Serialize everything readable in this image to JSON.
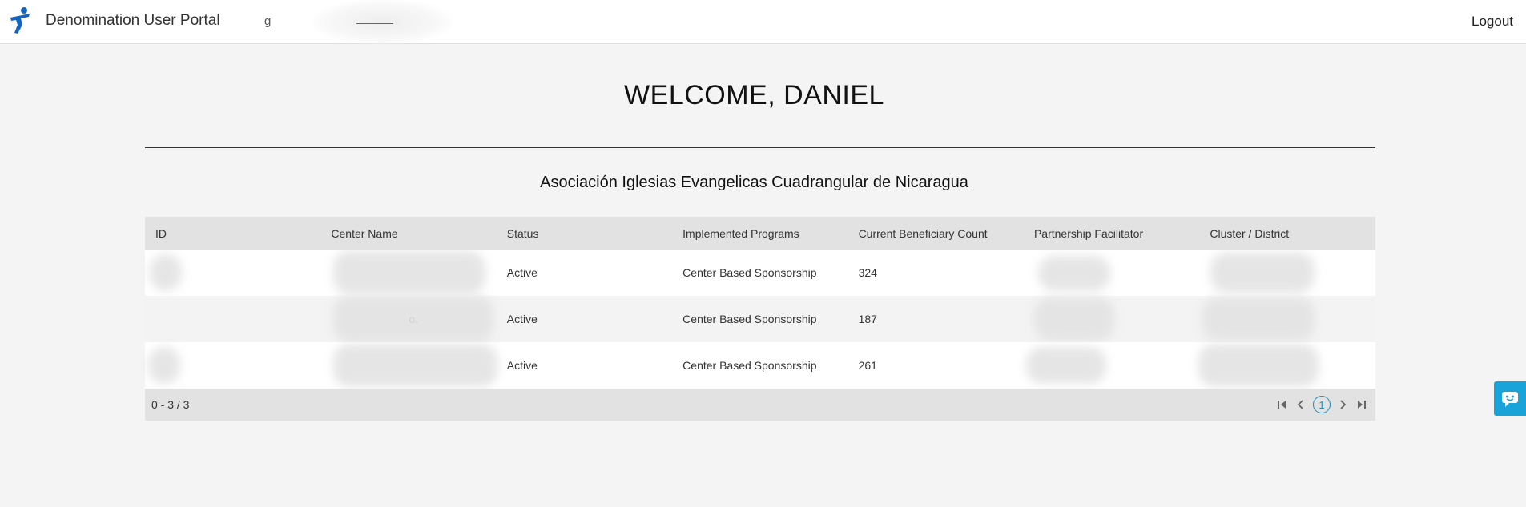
{
  "header": {
    "app_title": "Denomination User Portal",
    "org_short": "g",
    "logout_label": "Logout"
  },
  "welcome": "WELCOME, DANIEL",
  "organization": "Asociación Iglesias Evangelicas Cuadrangular de Nicaragua",
  "table": {
    "columns": [
      "ID",
      "Center Name",
      "Status",
      "Implemented Programs",
      "Current Beneficiary Count",
      "Partnership Facilitator",
      "Cluster / District"
    ],
    "rows": [
      {
        "id": "",
        "center_name": "",
        "status": "Active",
        "programs": "Center Based Sponsorship",
        "count": "324",
        "facilitator": "",
        "cluster": ""
      },
      {
        "id": "",
        "center_name": "o.",
        "status": "Active",
        "programs": "Center Based Sponsorship",
        "count": "187",
        "facilitator": "",
        "cluster": ""
      },
      {
        "id": "",
        "center_name": "",
        "status": "Active",
        "programs": "Center Based Sponsorship",
        "count": "261",
        "facilitator": "",
        "cluster": ""
      }
    ],
    "range_text": "0 - 3 / 3",
    "current_page": "1"
  },
  "colors": {
    "accent": "#1a8fc2",
    "chat": "#1aa3d8",
    "logo": "#1565c0"
  },
  "icons": [
    "logo-icon",
    "first-page-icon",
    "prev-page-icon",
    "next-page-icon",
    "last-page-icon",
    "chat-icon"
  ]
}
